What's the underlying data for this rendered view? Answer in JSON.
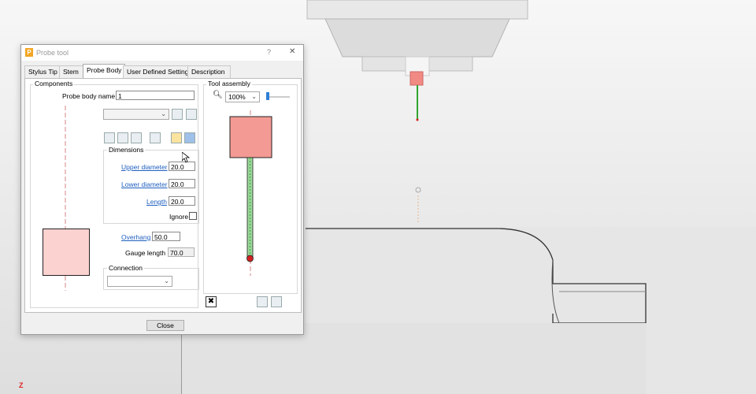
{
  "dialog": {
    "title": "Probe tool",
    "help": "?",
    "close": "✕",
    "tabs": [
      "Stylus Tip",
      "Stem",
      "Probe Body",
      "User Defined Settings",
      "Description"
    ],
    "active_tab": "Probe Body",
    "components": {
      "legend": "Components",
      "probe_body_name_label": "Probe body name",
      "probe_body_name_value": "1",
      "dimensions": {
        "legend": "Dimensions",
        "upper_diameter_label": "Upper diameter",
        "upper_diameter_value": "20.0",
        "lower_diameter_label": "Lower diameter",
        "lower_diameter_value": "20.0",
        "length_label": "Length",
        "length_value": "20.0",
        "ignore_label": "Ignore"
      },
      "overhang_label": "Overhang",
      "overhang_value": "50.0",
      "gauge_length_label": "Gauge length",
      "gauge_length_value": "70.0",
      "connection_legend": "Connection"
    },
    "tool_assembly": {
      "legend": "Tool assembly",
      "zoom_value": "100%"
    },
    "close_button": "Close"
  },
  "viewport": {
    "axis_label": "Z"
  },
  "colors": {
    "body_fill": "#f49a94",
    "body_fill_light": "#fbd2d0",
    "stem_green": "#2fa52f",
    "tip_red": "#d42020",
    "link": "#1f5fbf"
  }
}
